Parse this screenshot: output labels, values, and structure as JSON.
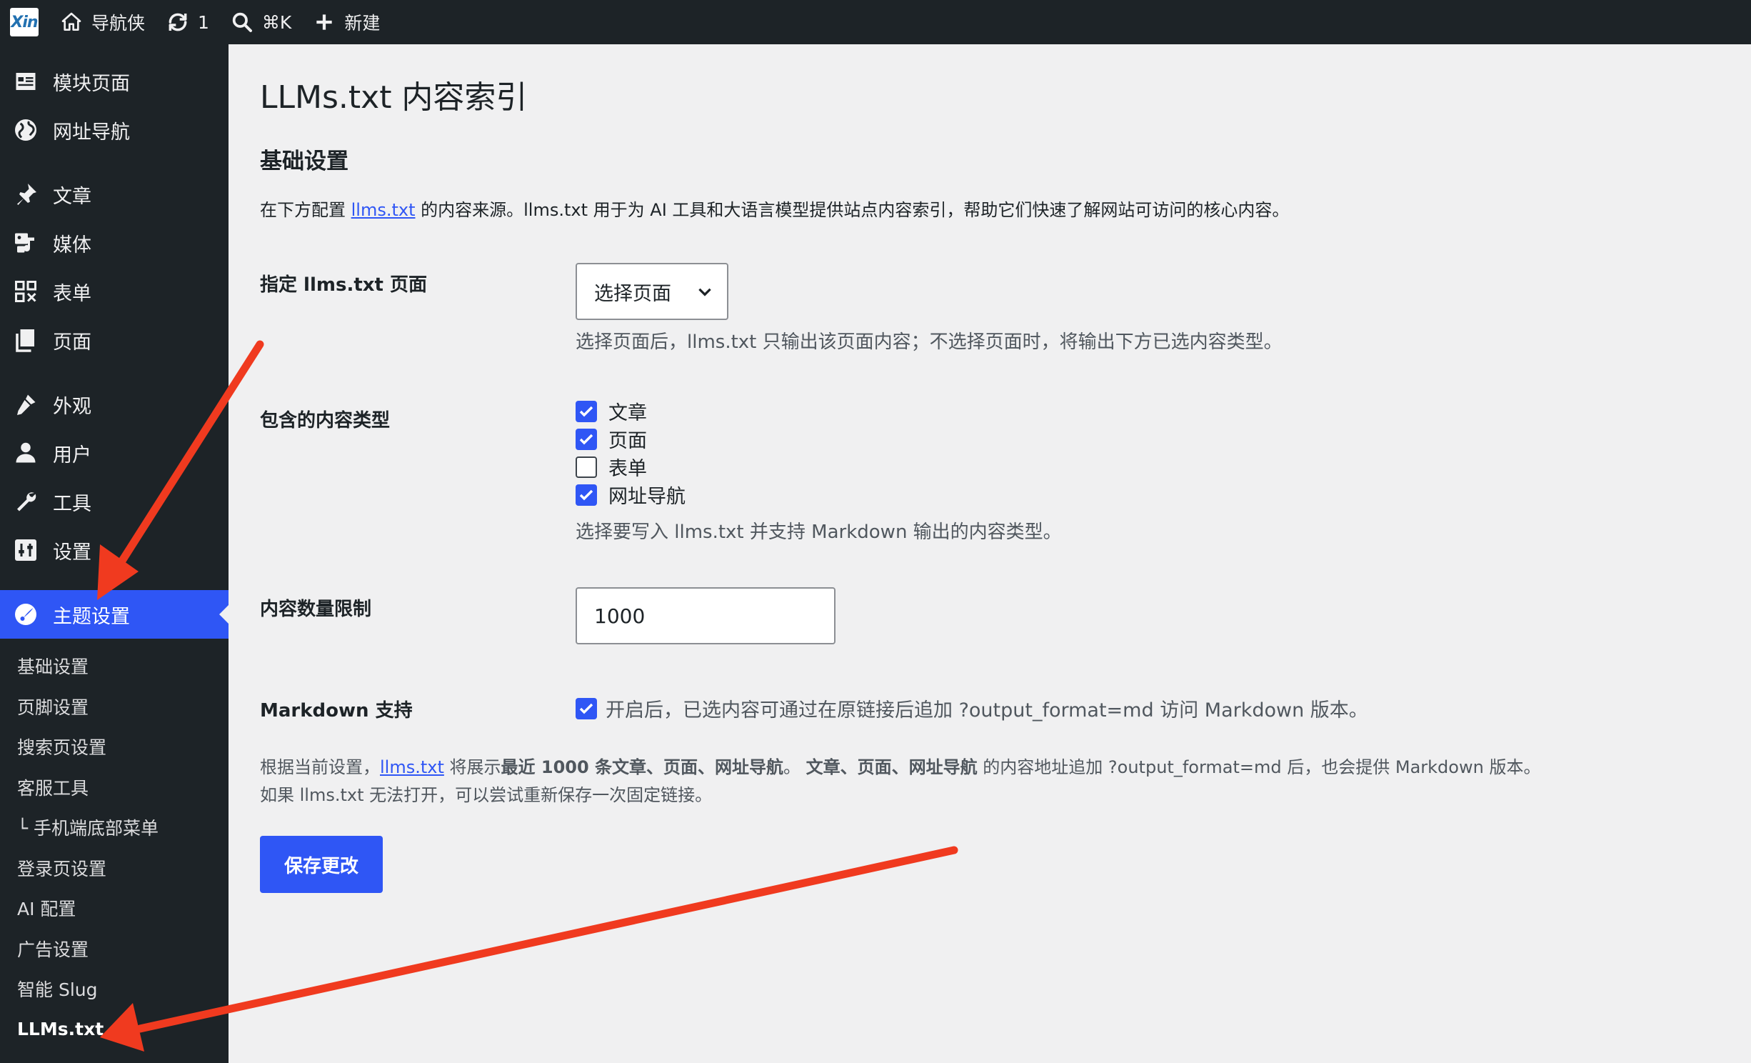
{
  "adminbar": {
    "logo": "Xin",
    "site_name": "导航侠",
    "updates_count": "1",
    "search_shortcut": "⌘K",
    "new_label": "新建"
  },
  "sidebar": {
    "items": [
      {
        "label": "模块页面",
        "icon": "layout-icon"
      },
      {
        "label": "网址导航",
        "icon": "globe-icon"
      },
      {
        "label": "文章",
        "icon": "pin-icon"
      },
      {
        "label": "媒体",
        "icon": "media-icon"
      },
      {
        "label": "表单",
        "icon": "form-icon"
      },
      {
        "label": "页面",
        "icon": "pages-icon"
      },
      {
        "label": "外观",
        "icon": "brush-icon"
      },
      {
        "label": "用户",
        "icon": "user-icon"
      },
      {
        "label": "工具",
        "icon": "wrench-icon"
      },
      {
        "label": "设置",
        "icon": "settings-icon"
      },
      {
        "label": "主题设置",
        "icon": "theme-icon"
      }
    ],
    "submenu": [
      "基础设置",
      "页脚设置",
      "搜索页设置",
      "客服工具",
      "└ 手机端底部菜单",
      "登录页设置",
      "AI 配置",
      "广告设置",
      "智能 Slug",
      "LLMs.txt"
    ]
  },
  "main": {
    "title": "LLMs.txt 内容索引",
    "section_title": "基础设置",
    "intro_pre": "在下方配置 ",
    "intro_link": "llms.txt",
    "intro_post": " 的内容来源。llms.txt 用于为 AI 工具和大语言模型提供站点内容索引，帮助它们快速了解网站可访问的核心内容。",
    "page_label": "指定 llms.txt 页面",
    "page_select": "选择页面",
    "page_desc": "选择页面后，llms.txt 只输出该页面内容；不选择页面时，将输出下方已选内容类型。",
    "types_label": "包含的内容类型",
    "types": [
      {
        "label": "文章",
        "checked": true
      },
      {
        "label": "页面",
        "checked": true
      },
      {
        "label": "表单",
        "checked": false
      },
      {
        "label": "网址导航",
        "checked": true
      }
    ],
    "types_desc": "选择要写入 llms.txt 并支持 Markdown 输出的内容类型。",
    "limit_label": "内容数量限制",
    "limit_value": "1000",
    "md_label": "Markdown 支持",
    "md_checked": true,
    "md_text": "开启后，已选内容可通过在原链接后追加 ?output_format=md 访问 Markdown 版本。",
    "note1_pre": "根据当前设置，",
    "note1_link": "llms.txt",
    "note1_mid": " 将展示",
    "note1_bold1": "最近 1000 条文章、页面、网址导航",
    "note1_sep": "。 ",
    "note1_bold2": "文章、页面、网址导航",
    "note1_post": " 的内容地址追加 ?output_format=md 后，也会提供 Markdown 版本。",
    "note2": "如果 llms.txt 无法打开，可以尝试重新保存一次固定链接。",
    "save_button": "保存更改"
  },
  "colors": {
    "accent": "#2f56f5",
    "sidebar_bg": "#1d2327",
    "arrow": "#f03a1f"
  }
}
